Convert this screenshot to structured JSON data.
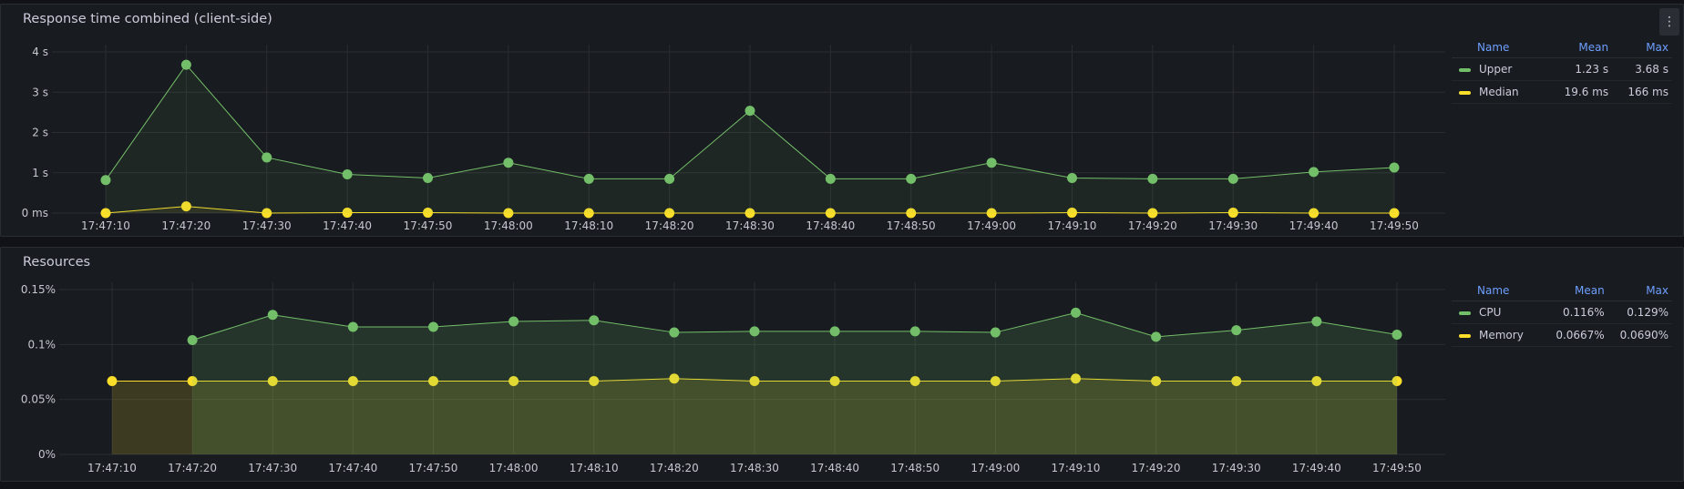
{
  "panels": [
    {
      "title": "Response time combined (client-side)",
      "legend": {
        "headers": {
          "name": "Name",
          "mean": "Mean",
          "max": "Max"
        },
        "rows": [
          {
            "name": "Upper",
            "mean": "1.23 s",
            "max": "3.68 s",
            "color": "#73bf69"
          },
          {
            "name": "Median",
            "mean": "19.6 ms",
            "max": "166 ms",
            "color": "#fade2a"
          }
        ]
      }
    },
    {
      "title": "Resources",
      "legend": {
        "headers": {
          "name": "Name",
          "mean": "Mean",
          "max": "Max"
        },
        "rows": [
          {
            "name": "CPU",
            "mean": "0.116%",
            "max": "0.129%",
            "color": "#73bf69"
          },
          {
            "name": "Memory",
            "mean": "0.0667%",
            "max": "0.0690%",
            "color": "#fade2a"
          }
        ]
      }
    }
  ],
  "chart_data": [
    {
      "type": "line",
      "title": "Response time combined (client-side)",
      "x": [
        "17:47:10",
        "17:47:20",
        "17:47:30",
        "17:47:40",
        "17:47:50",
        "17:48:00",
        "17:48:10",
        "17:48:20",
        "17:48:30",
        "17:48:40",
        "17:48:50",
        "17:49:00",
        "17:49:10",
        "17:49:20",
        "17:49:30",
        "17:49:40",
        "17:49:50"
      ],
      "y_ticks": [
        "0 ms",
        "1 s",
        "2 s",
        "3 s",
        "4 s"
      ],
      "ylim": [
        0,
        4
      ],
      "y_unit": "s",
      "grid": true,
      "legend_placement": "right",
      "series": [
        {
          "name": "Upper",
          "color": "#73bf69",
          "values": [
            0.82,
            3.68,
            1.38,
            0.96,
            0.87,
            1.25,
            0.85,
            0.85,
            2.54,
            0.85,
            0.85,
            1.25,
            0.87,
            0.85,
            0.85,
            1.02,
            1.13
          ]
        },
        {
          "name": "Median",
          "color": "#fade2a",
          "values": [
            0.0,
            0.166,
            0.0,
            0.01,
            0.01,
            0.0,
            0.0,
            0.0,
            0.0,
            0.0,
            0.0,
            0.0,
            0.01,
            0.0,
            0.01,
            0.0,
            0.0
          ]
        }
      ]
    },
    {
      "type": "area",
      "title": "Resources",
      "x": [
        "17:47:10",
        "17:47:20",
        "17:47:30",
        "17:47:40",
        "17:47:50",
        "17:48:00",
        "17:48:10",
        "17:48:20",
        "17:48:30",
        "17:48:40",
        "17:48:50",
        "17:49:00",
        "17:49:10",
        "17:49:20",
        "17:49:30",
        "17:49:40",
        "17:49:50"
      ],
      "y_ticks": [
        "0%",
        "0.05%",
        "0.1%",
        "0.15%"
      ],
      "ylim": [
        0,
        0.15
      ],
      "y_unit": "%",
      "grid": true,
      "legend_placement": "right",
      "series": [
        {
          "name": "CPU",
          "color": "#73bf69",
          "values": [
            null,
            0.104,
            0.127,
            0.116,
            0.116,
            0.121,
            0.122,
            0.111,
            0.112,
            0.112,
            0.112,
            0.111,
            0.129,
            0.107,
            0.113,
            0.121,
            0.109
          ]
        },
        {
          "name": "Memory",
          "color": "#fade2a",
          "values": [
            0.0667,
            0.0667,
            0.0667,
            0.0667,
            0.0667,
            0.0667,
            0.0667,
            0.069,
            0.0667,
            0.0667,
            0.0667,
            0.0667,
            0.069,
            0.0667,
            0.0667,
            0.0667,
            0.0667
          ]
        }
      ]
    }
  ]
}
